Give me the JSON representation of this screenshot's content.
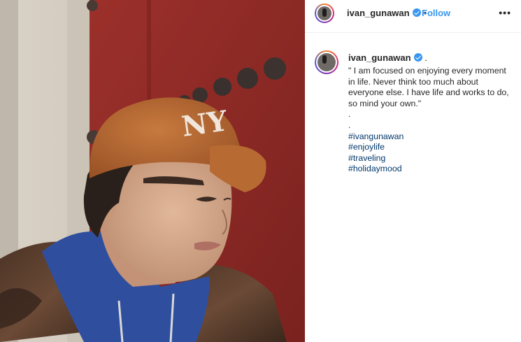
{
  "post": {
    "username": "ivan_gunawan",
    "follow_label": "Follow",
    "separator": "•",
    "more_label": "•••"
  },
  "caption": {
    "username": "ivan_gunawan",
    "after_name": ".",
    "text": "\" I am focused on enjoying every moment in life. Never think too much about everyone else. I have life and works to do, so mind your own.\"",
    "dots": [
      ".",
      "."
    ],
    "hashtags": [
      "#ivangunawan",
      "#enjoylife",
      "#traveling",
      "#holidaymood"
    ]
  },
  "colors": {
    "link": "#3897f0",
    "hashtag": "#00376b",
    "text": "#262626",
    "door_red": "#8e2a27",
    "cap_brown": "#b5652f",
    "hoodie_blue": "#2f4f9e"
  },
  "icons": {
    "verified": "verified-badge-icon",
    "avatar": "profile-avatar"
  }
}
